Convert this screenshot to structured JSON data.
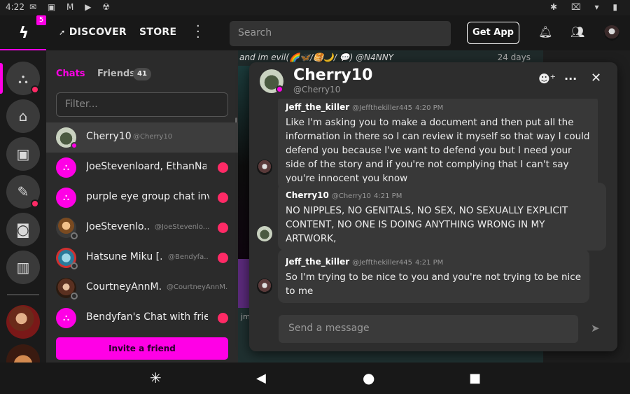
{
  "status_bar": {
    "time": "4:22",
    "left_icons": "✉ ▣ M ▶ ☢",
    "right_icons": "✱ ⌧ ▾ ▮"
  },
  "nav": {
    "logo_badge": "5",
    "discover": "DISCOVER",
    "store": "STORE",
    "search_placeholder": "Search",
    "get_app": "Get App"
  },
  "sidebar": {
    "tabs": {
      "chats": "Chats",
      "friends": "Friends",
      "friends_count": "41"
    },
    "filter_placeholder": "Filter...",
    "chats": [
      {
        "name": "Cherry10",
        "handle": "@Cherry10",
        "selected": true,
        "avatar": "cherry"
      },
      {
        "name": "JoeStevenloard, EthanNat...",
        "handle": "",
        "avatar": "group",
        "unread": true
      },
      {
        "name": "purple eye group chat invi...",
        "handle": "",
        "avatar": "group",
        "unread": true
      },
      {
        "name": "JoeStevenlo...",
        "handle": "@JoeStevenlo...",
        "avatar": "joe",
        "unread": true
      },
      {
        "name": "Hatsune Miku [...",
        "handle": "@Bendyfa...",
        "avatar": "miku",
        "unread": true
      },
      {
        "name": "CourtneyAnnM...",
        "handle": "@CourtneyAnnM...",
        "avatar": "courtney",
        "unread": false
      },
      {
        "name": "Bendyfan's Chat with frie...",
        "handle": "",
        "avatar": "group",
        "unread": true
      }
    ],
    "invite_label": "Invite a friend"
  },
  "feed": {
    "banner_text": "and im evil(🌈🦋/🥞🌙/ 💬) @N4NNY",
    "banner_time": "24 days",
    "partial_text": "jm"
  },
  "chat_window": {
    "name": "Cherry10",
    "handle": "@Cherry10",
    "messages": [
      {
        "author": "Jeff_the_killer",
        "handle": "@Jeffthekiller445",
        "time": "4:20 PM",
        "body": "Like I'm asking you to make a document and then put all the information in there so I can review it myself so that way I could defend you because I've want to defend you but I need your side of the story and if you're not complying that I can't say you're innocent you know"
      },
      {
        "author": "Cherry10",
        "handle": "@Cherry10",
        "time": "4:21 PM",
        "body": "NO NIPPLES, NO GENITALS, NO SEX, NO SEXUALLY EXPLICIT CONTENT, NO ONE IS DOING ANYTHING WRONG IN MY ARTWORK,"
      },
      {
        "author": "Jeff_the_killer",
        "handle": "@Jeffthekiller445",
        "time": "4:21 PM",
        "body": "So I'm trying to be nice to you and you're not trying to be nice to me"
      }
    ],
    "composer_placeholder": "Send a message"
  },
  "colors": {
    "accent": "#ff00e6",
    "unread": "#ff2a66",
    "online": "#ff00e6"
  }
}
